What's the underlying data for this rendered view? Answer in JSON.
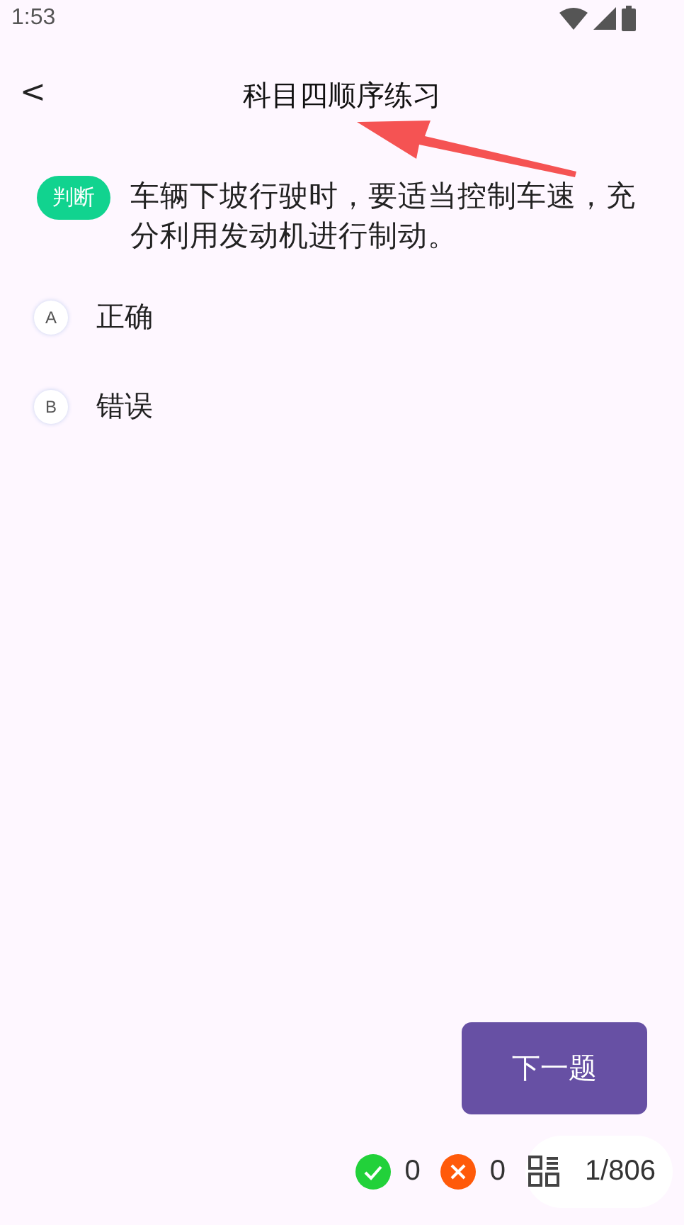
{
  "status_bar": {
    "time": "1:53"
  },
  "header": {
    "back": "<",
    "title": "科目四顺序练习"
  },
  "question": {
    "type_badge": "判断",
    "text": "车辆下坡行驶时，要适当控制车速，充分利用发动机进行制动。"
  },
  "options": [
    {
      "letter": "A",
      "text": "正确",
      "selected": false
    },
    {
      "letter": "B",
      "text": "错误",
      "selected": false
    }
  ],
  "next_button": "下一题",
  "footer": {
    "correct_count": "0",
    "wrong_count": "0",
    "progress": "1/806"
  }
}
